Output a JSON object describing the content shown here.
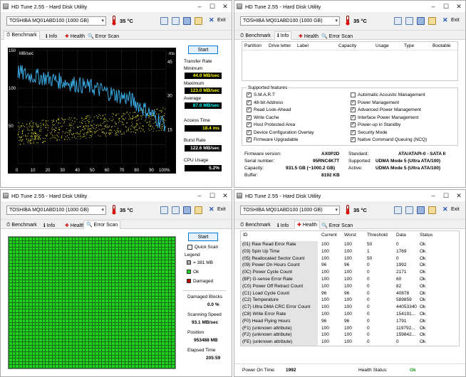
{
  "app_title": "HD Tune 2.55 - Hard Disk Utility",
  "drive": "TOSHIBA MQ01ABD100 (1000 GB)",
  "temperature": "35 °C",
  "exit_label": "Exit",
  "tabs": {
    "benchmark": "Benchmark",
    "info": "Info",
    "health": "Health",
    "error_scan": "Error Scan"
  },
  "benchmark": {
    "start": "Start",
    "y_left_unit": "MB/sec",
    "y_right_unit": "ms",
    "y_left_ticks": [
      "150",
      "100",
      "50"
    ],
    "y_right_ticks": [
      "45",
      "30",
      "15"
    ],
    "x_ticks": [
      "0",
      "10",
      "20",
      "30",
      "40",
      "50",
      "60",
      "70",
      "80",
      "90",
      "100%"
    ],
    "transfer_rate_label": "Transfer Rate",
    "minimum_label": "Minimum",
    "minimum": "44.0 MB/sec",
    "maximum_label": "Maximum",
    "maximum": "123.0 MB/sec",
    "average_label": "Average",
    "average": "87.0 MB/sec",
    "access_time_label": "Access Time",
    "access_time": "18.4 ms",
    "burst_rate_label": "Burst Rate",
    "burst_rate": "122.6 MB/sec",
    "cpu_usage_label": "CPU Usage",
    "cpu_usage": "5.2%",
    "chart_data": {
      "type": "line",
      "x": [
        0,
        5,
        10,
        15,
        20,
        25,
        30,
        35,
        40,
        45,
        50,
        55,
        60,
        65,
        70,
        75,
        80,
        85,
        90,
        95,
        100
      ],
      "series": [
        {
          "values": [
            122,
            118,
            116,
            115,
            113,
            111,
            109,
            107,
            105,
            103,
            101,
            98,
            95,
            92,
            89,
            86,
            80,
            73,
            66,
            58,
            52
          ]
        }
      ],
      "ylim": [
        0,
        150
      ],
      "y2lim": [
        0,
        50
      ],
      "grid": true,
      "colors": {
        "transfer": "#3aa8e0",
        "access": "#e8e830"
      }
    }
  },
  "info": {
    "columns": [
      "Partition",
      "Drive letter",
      "Label",
      "Capacity",
      "Usage",
      "Type",
      "Bootable"
    ],
    "features_title": "Supported features",
    "features_left": [
      "S.M.A.R.T",
      "48-bit Address",
      "Read Look-Ahead",
      "Write Cache",
      "Host Protected Area",
      "Device Configuration Overlay",
      "Firmware Upgradable"
    ],
    "features_right": [
      "Automatic Acoustic Management",
      "Power Management",
      "Advanced Power Management",
      "Interface Power Management",
      "Power-up in Standby",
      "Security Mode",
      "Native Command Queuing (NCQ)"
    ],
    "features_left_checked": [
      true,
      true,
      true,
      true,
      true,
      true,
      true
    ],
    "features_right_checked": [
      false,
      true,
      true,
      true,
      true,
      true,
      true
    ],
    "firmware_label": "Firmware version:",
    "firmware": "AX0P2D",
    "serial_label": "Serial number:",
    "serial": "95RNC4K7T",
    "capacity_label": "Capacity:",
    "capacity": "931.5 GB (~1000.2 GB)",
    "buffer_label": "Buffer:",
    "buffer": "8192 KB",
    "standard_label": "Standard:",
    "standard": "ATA/ATAPI-0 - SATA II",
    "supported_label": "Supported:",
    "supported": "UDMA Mode 5 (Ultra ATA/100)",
    "active_label": "Active:",
    "active": "UDMA Mode 5 (Ultra ATA/100)"
  },
  "errorscan": {
    "start": "Start",
    "quick_scan": "Quick Scan",
    "legend_label": "Legend",
    "legend_block": "= 381 MB",
    "legend_ok": "Ok",
    "legend_damaged": "Damaged",
    "damaged_blocks_label": "Damaged Blocks",
    "damaged_blocks": "0.0 %",
    "scanning_speed_label": "Scanning Speed",
    "scanning_speed": "93.1 MB/sec",
    "position_label": "Position",
    "position": "953488 MB",
    "elapsed_label": "Elapsed Time",
    "elapsed": "205:59",
    "colors": {
      "ok": "#1ed21e",
      "damaged": "#c00000"
    }
  },
  "health": {
    "columns": [
      "ID",
      "Current",
      "Worst",
      "Threshold",
      "Data",
      "Status"
    ],
    "rows": [
      [
        "(01) Raw Read Error Rate",
        "100",
        "100",
        "50",
        "0",
        "Ok"
      ],
      [
        "(03) Spin Up Time",
        "100",
        "100",
        "1",
        "1769",
        "Ok"
      ],
      [
        "(05) Reallocated Sector Count",
        "100",
        "100",
        "50",
        "0",
        "Ok"
      ],
      [
        "(09) Power On Hours Count",
        "96",
        "96",
        "0",
        "1992",
        "Ok"
      ],
      [
        "(0C) Power Cycle Count",
        "100",
        "100",
        "0",
        "2171",
        "Ok"
      ],
      [
        "(BF) G-sense Error Rate",
        "100",
        "100",
        "0",
        "60",
        "Ok"
      ],
      [
        "(C0) Power Off Retract Count",
        "100",
        "100",
        "0",
        "82",
        "Ok"
      ],
      [
        "(C1) Load Cycle Count",
        "96",
        "96",
        "0",
        "40878",
        "Ok"
      ],
      [
        "(C2) Temperature",
        "100",
        "100",
        "0",
        "589859",
        "Ok"
      ],
      [
        "(C7) Ultra DMA CRC Error Count",
        "100",
        "100",
        "0",
        "44053340",
        "Ok"
      ],
      [
        "(C8) Write Error Rate",
        "100",
        "100",
        "0",
        "154191...",
        "Ok"
      ],
      [
        "(F0) Head Flying Hours",
        "96",
        "96",
        "0",
        "1791",
        "Ok"
      ],
      [
        "(F1) (unknown attribute)",
        "100",
        "100",
        "0",
        "119792...",
        "Ok"
      ],
      [
        "(F2) (unknown attribute)",
        "100",
        "100",
        "0",
        "159842...",
        "Ok"
      ],
      [
        "(FE) (unknown attribute)",
        "100",
        "100",
        "0",
        "0",
        "Ok"
      ]
    ],
    "power_on_label": "Power On Time:",
    "power_on": "1992",
    "health_status_label": "Health Status:",
    "health_status": "Ok",
    "colors": {
      "ok": "#1e9e1e"
    }
  }
}
